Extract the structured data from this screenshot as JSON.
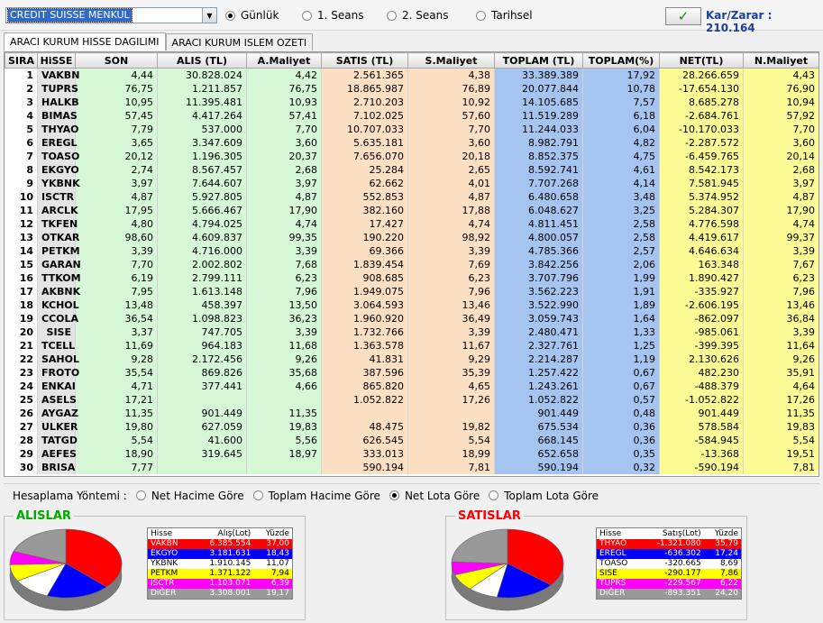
{
  "toolbar": {
    "broker": "CREDIT SUISSE MENKUL",
    "radios": [
      {
        "label": "Günlük",
        "selected": true
      },
      {
        "label": "1. Seans",
        "selected": false
      },
      {
        "label": "2. Seans",
        "selected": false
      },
      {
        "label": "Tarihsel",
        "selected": false
      }
    ],
    "ok_icon": "check-icon",
    "kar_zarar": "Kar/Zarar : 210.164"
  },
  "tabs": [
    "ARACI KURUM HISSE DAGILIMI",
    "ARACI KURUM ISLEM OZETI"
  ],
  "table": {
    "columns": [
      "SIRA",
      "HiSSE",
      "SON",
      "ALIS (TL)",
      "A.Maliyet",
      "SATIS (TL)",
      "S.Maliyet",
      "TOPLAM (TL)",
      "TOPLAM(%)",
      "NET(TL)",
      "N.Maliyet"
    ],
    "rows": [
      [
        "1",
        "VAKBN",
        "4,44",
        "30.828.024",
        "4,42",
        "2.561.365",
        "4,38",
        "33.389.389",
        "17,92",
        "28.266.659",
        "4,43"
      ],
      [
        "2",
        "TUPRS",
        "76,75",
        "1.211.857",
        "76,75",
        "18.865.987",
        "76,89",
        "20.077.844",
        "10,78",
        "-17.654.130",
        "76,90"
      ],
      [
        "3",
        "HALKB",
        "10,95",
        "11.395.481",
        "10,93",
        "2.710.203",
        "10,92",
        "14.105.685",
        "7,57",
        "8.685.278",
        "10,94"
      ],
      [
        "4",
        "BIMAS",
        "57,45",
        "4.417.264",
        "57,41",
        "7.102.025",
        "57,60",
        "11.519.289",
        "6,18",
        "-2.684.761",
        "57,92"
      ],
      [
        "5",
        "THYAO",
        "7,79",
        "537.000",
        "7,70",
        "10.707.033",
        "7,70",
        "11.244.033",
        "6,04",
        "-10.170.033",
        "7,70"
      ],
      [
        "6",
        "EREGL",
        "3,65",
        "3.347.609",
        "3,60",
        "5.635.181",
        "3,60",
        "8.982.791",
        "4,82",
        "-2.287.572",
        "3,60"
      ],
      [
        "7",
        "TOASO",
        "20,12",
        "1.196.305",
        "20,37",
        "7.656.070",
        "20,18",
        "8.852.375",
        "4,75",
        "-6.459.765",
        "20,14"
      ],
      [
        "8",
        "EKGYO",
        "2,74",
        "8.567.457",
        "2,68",
        "25.284",
        "2,65",
        "8.592.741",
        "4,61",
        "8.542.173",
        "2,68"
      ],
      [
        "9",
        "YKBNK",
        "3,97",
        "7.644.607",
        "3,97",
        "62.662",
        "4,01",
        "7.707.268",
        "4,14",
        "7.581.945",
        "3,97"
      ],
      [
        "10",
        "ISCTR",
        "4,87",
        "5.927.805",
        "4,87",
        "552.853",
        "4,87",
        "6.480.658",
        "3,48",
        "5.374.952",
        "4,87"
      ],
      [
        "11",
        "ARCLK",
        "17,95",
        "5.666.467",
        "17,90",
        "382.160",
        "17,88",
        "6.048.627",
        "3,25",
        "5.284.307",
        "17,90"
      ],
      [
        "12",
        "TKFEN",
        "4,80",
        "4.794.025",
        "4,74",
        "17.427",
        "4,74",
        "4.811.451",
        "2,58",
        "4.776.598",
        "4,74"
      ],
      [
        "13",
        "OTKAR",
        "98,60",
        "4.609.837",
        "99,35",
        "190.220",
        "98,92",
        "4.800.057",
        "2,58",
        "4.419.617",
        "99,37"
      ],
      [
        "14",
        "PETKM",
        "3,39",
        "4.716.000",
        "3,39",
        "69.366",
        "3,39",
        "4.785.366",
        "2,57",
        "4.646.634",
        "3,39"
      ],
      [
        "15",
        "GARAN",
        "7,70",
        "2.002.802",
        "7,68",
        "1.839.454",
        "7,69",
        "3.842.256",
        "2,06",
        "163.348",
        "7,67"
      ],
      [
        "16",
        "TTKOM",
        "6,19",
        "2.799.111",
        "6,23",
        "908.685",
        "6,23",
        "3.707.796",
        "1,99",
        "1.890.427",
        "6,23"
      ],
      [
        "17",
        "AKBNK",
        "7,95",
        "1.613.148",
        "7,96",
        "1.949.075",
        "7,96",
        "3.562.223",
        "1,91",
        "-335.927",
        "7,96"
      ],
      [
        "18",
        "KCHOL",
        "13,48",
        "458.397",
        "13,50",
        "3.064.593",
        "13,46",
        "3.522.990",
        "1,89",
        "-2.606.195",
        "13,46"
      ],
      [
        "19",
        "CCOLA",
        "36,54",
        "1.098.823",
        "36,23",
        "1.960.920",
        "36,49",
        "3.059.743",
        "1,64",
        "-862.097",
        "36,84"
      ],
      [
        "20",
        "SISE",
        "3,37",
        "747.705",
        "3,39",
        "1.732.766",
        "3,39",
        "2.480.471",
        "1,33",
        "-985.061",
        "3,39"
      ],
      [
        "21",
        "TCELL",
        "11,69",
        "964.183",
        "11,68",
        "1.363.578",
        "11,67",
        "2.327.761",
        "1,25",
        "-399.395",
        "11,64"
      ],
      [
        "22",
        "SAHOL",
        "9,28",
        "2.172.456",
        "9,26",
        "41.831",
        "9,29",
        "2.214.287",
        "1,19",
        "2.130.626",
        "9,26"
      ],
      [
        "23",
        "FROTO",
        "35,54",
        "869.826",
        "35,68",
        "387.596",
        "35,39",
        "1.257.422",
        "0,67",
        "482.230",
        "35,91"
      ],
      [
        "24",
        "ENKAI",
        "4,71",
        "377.441",
        "4,66",
        "865.820",
        "4,65",
        "1.243.261",
        "0,67",
        "-488.379",
        "4,64"
      ],
      [
        "25",
        "ASELS",
        "17,21",
        "",
        "",
        "1.052.822",
        "17,26",
        "1.052.822",
        "0,57",
        "-1.052.822",
        "17,26"
      ],
      [
        "26",
        "AYGAZ",
        "11,35",
        "901.449",
        "11,35",
        "",
        "",
        "901.449",
        "0,48",
        "901.449",
        "11,35"
      ],
      [
        "27",
        "ULKER",
        "19,80",
        "627.059",
        "19,83",
        "48.475",
        "19,82",
        "675.534",
        "0,36",
        "578.584",
        "19,83"
      ],
      [
        "28",
        "TATGD",
        "5,54",
        "41.600",
        "5,56",
        "626.545",
        "5,54",
        "668.145",
        "0,36",
        "-584.945",
        "5,54"
      ],
      [
        "29",
        "AEFES",
        "18,90",
        "319.645",
        "18,97",
        "333.013",
        "18,99",
        "652.658",
        "0,35",
        "-13.368",
        "19,51"
      ],
      [
        "30",
        "BRISA",
        "7,77",
        "",
        "",
        "590.194",
        "7,81",
        "590.194",
        "0,32",
        "-590.194",
        "7,81"
      ]
    ]
  },
  "method": {
    "label": "Hesaplama Yöntemi :",
    "options": [
      {
        "label": "Net Hacime Göre",
        "selected": false
      },
      {
        "label": "Toplam Hacime Göre",
        "selected": false
      },
      {
        "label": "Net Lota Göre",
        "selected": true
      },
      {
        "label": "Toplam Lota Göre",
        "selected": false
      }
    ]
  },
  "alislar": {
    "title": "ALISLAR",
    "title_color": "#00aa00",
    "headers": [
      "Hisse",
      "Alış(Lot)",
      "Yüzde"
    ],
    "rows": [
      {
        "name": "VAKBN",
        "lot": "6.385.554",
        "pct": "37,00",
        "pct_value": 37.0,
        "color": "#ff0000",
        "text": "#ffffff"
      },
      {
        "name": "EKGYO",
        "lot": "3.181.631",
        "pct": "18,43",
        "pct_value": 18.43,
        "color": "#0000ff",
        "text": "#ffffff"
      },
      {
        "name": "YKBNK",
        "lot": "1.910.145",
        "pct": "11,07",
        "pct_value": 11.07,
        "color": "#ffffff",
        "text": "#000000"
      },
      {
        "name": "PETKM",
        "lot": "1.371.122",
        "pct": "7,94",
        "pct_value": 7.94,
        "color": "#ffff00",
        "text": "#000000"
      },
      {
        "name": "ISCTR",
        "lot": "1.103.071",
        "pct": "6,39",
        "pct_value": 6.39,
        "color": "#ff00ff",
        "text": "#ffffff"
      },
      {
        "name": "DiĞER",
        "lot": "3.308.001",
        "pct": "19,17",
        "pct_value": 19.17,
        "color": "#999999",
        "text": "#ffffff"
      }
    ]
  },
  "satislar": {
    "title": "SATISLAR",
    "title_color": "#ff0000",
    "headers": [
      "Hisse",
      "Satış(Lot)",
      "Yüzde"
    ],
    "rows": [
      {
        "name": "THYAO",
        "lot": "-1.321.080",
        "pct": "35,79",
        "pct_value": 35.79,
        "color": "#ff0000",
        "text": "#ffffff"
      },
      {
        "name": "EREGL",
        "lot": "-636.302",
        "pct": "17,24",
        "pct_value": 17.24,
        "color": "#0000ff",
        "text": "#ffffff"
      },
      {
        "name": "TOASO",
        "lot": "-320.665",
        "pct": "8,69",
        "pct_value": 8.69,
        "color": "#ffffff",
        "text": "#000000"
      },
      {
        "name": "SISE",
        "lot": "-290.177",
        "pct": "7,86",
        "pct_value": 7.86,
        "color": "#ffff00",
        "text": "#000000"
      },
      {
        "name": "TUPRS",
        "lot": "-229.567",
        "pct": "6,22",
        "pct_value": 6.22,
        "color": "#ff00ff",
        "text": "#ffffff"
      },
      {
        "name": "DiĞER",
        "lot": "-893.351",
        "pct": "24,20",
        "pct_value": 24.2,
        "color": "#999999",
        "text": "#ffffff"
      }
    ]
  }
}
